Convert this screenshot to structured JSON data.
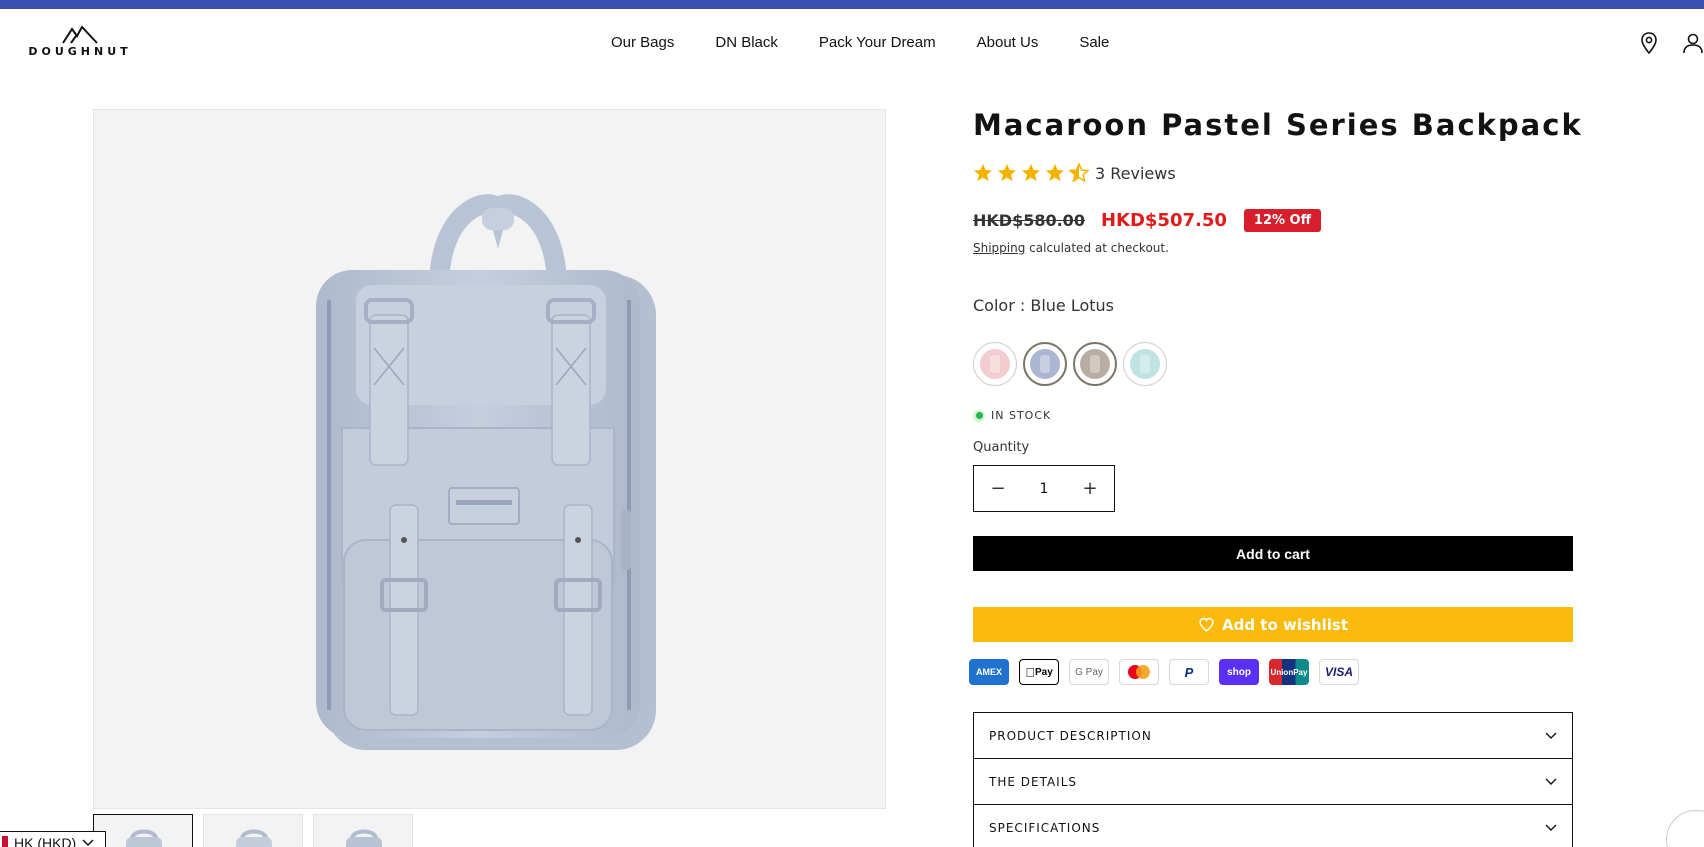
{
  "brand": {
    "logo_text": "DOUGHNUT"
  },
  "nav": {
    "items": [
      "Our Bags",
      "DN Black",
      "Pack Your Dream",
      "About Us",
      "Sale"
    ]
  },
  "header_icons": {
    "location": "location-pin-icon",
    "account": "account-icon"
  },
  "product": {
    "title": "Macaroon Pastel Series Backpack",
    "rating": 4.5,
    "reviews_label": "3 Reviews",
    "old_price": "HKD$580.00",
    "new_price": "HKD$507.50",
    "discount_badge": "12% Off",
    "shipping_link": "Shipping",
    "shipping_text": " calculated at checkout.",
    "color_label": "Color : Blue Lotus",
    "swatches": [
      {
        "name": "pink",
        "color": "#f2cccf"
      },
      {
        "name": "blue-lotus",
        "color": "#aab6d2",
        "selected": true
      },
      {
        "name": "taupe",
        "color": "#b9ada3"
      },
      {
        "name": "mint",
        "color": "#bfe3e3"
      }
    ],
    "stock_label": "IN STOCK",
    "quantity_label": "Quantity",
    "quantity_value": "1",
    "minus": "−",
    "plus": "+",
    "add_to_cart": "Add to cart",
    "add_to_wishlist": "Add to wishlist"
  },
  "payments": [
    "AMEX",
    "Pay",
    "G Pay",
    "mastercard",
    "P",
    "shop",
    "UnionPay",
    "VISA"
  ],
  "accordions": [
    "PRODUCT DESCRIPTION",
    "THE DETAILS",
    "SPECIFICATIONS"
  ],
  "locale": {
    "label": "HK (HKD)"
  },
  "colors": {
    "accent": "#3b4fb3",
    "sale": "#e21a1a",
    "badge": "#d61f2b",
    "wishlist": "#fbbb0d",
    "star": "#f5b301"
  }
}
